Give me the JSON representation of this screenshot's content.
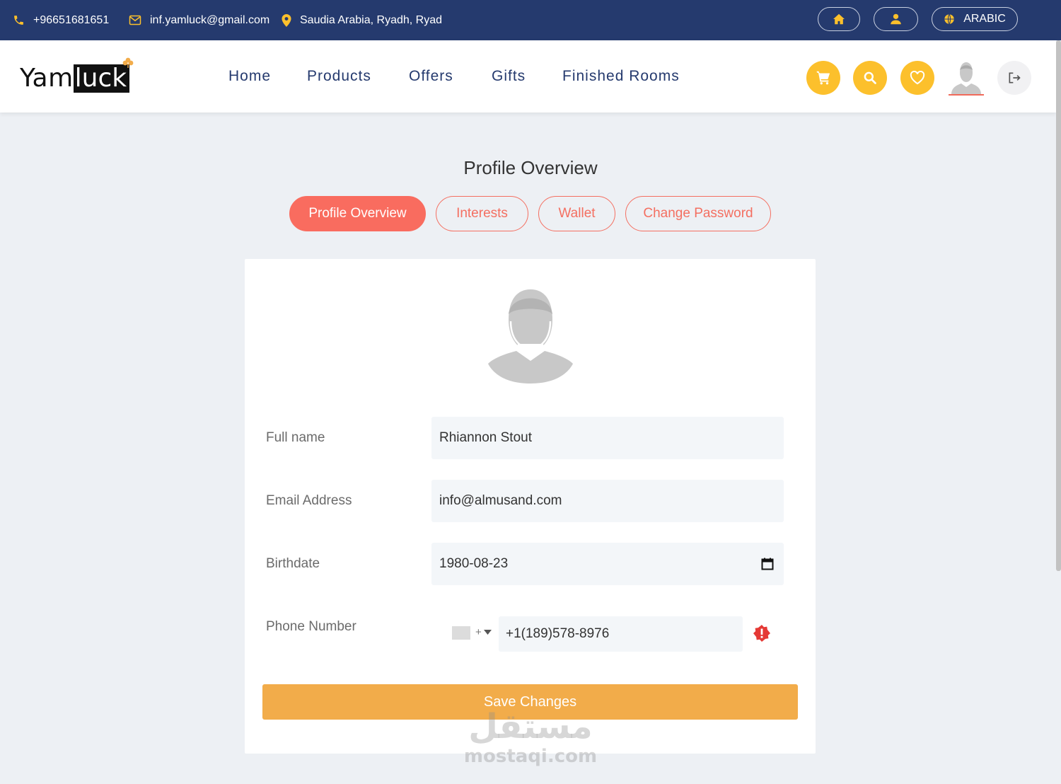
{
  "topbar": {
    "phone": "+96651681651",
    "email": "inf.yamluck@gmail.com",
    "location": "Saudia Arabia, Ryadh, Ryad",
    "language_label": "ARABIC"
  },
  "brand": {
    "logo_part1": "Yam",
    "logo_part2": "luck"
  },
  "nav": {
    "items": [
      "Home",
      "Products",
      "Offers",
      "Gifts",
      "Finished Rooms"
    ]
  },
  "page": {
    "title": "Profile Overview"
  },
  "tabs": [
    {
      "label": "Profile Overview",
      "active": true
    },
    {
      "label": "Interests",
      "active": false
    },
    {
      "label": "Wallet",
      "active": false
    },
    {
      "label": "Change Password",
      "active": false
    }
  ],
  "form": {
    "full_name": {
      "label": "Full name",
      "value": "Rhiannon Stout"
    },
    "email": {
      "label": "Email Address",
      "value": "info@almusand.com"
    },
    "birthdate": {
      "label": "Birthdate",
      "value": "1980-08-23"
    },
    "phone": {
      "label": "Phone Number",
      "dial_code": "+",
      "value": "+1(189)578-8976"
    },
    "save_label": "Save Changes"
  },
  "watermark": {
    "arabic": "مستقل",
    "latin": "mostaqi.com"
  },
  "colors": {
    "topbar": "#253a6e",
    "accent_yellow": "#fcc02c",
    "tab_coral": "#f96c5f",
    "save_orange": "#f2ac4a"
  },
  "icons": [
    "phone-icon",
    "mail-icon",
    "location-pin-icon",
    "home-icon",
    "user-icon",
    "globe-icon",
    "cart-icon",
    "search-icon",
    "heart-icon",
    "logout-icon",
    "calendar-icon",
    "alert-icon",
    "chevron-down-icon"
  ]
}
